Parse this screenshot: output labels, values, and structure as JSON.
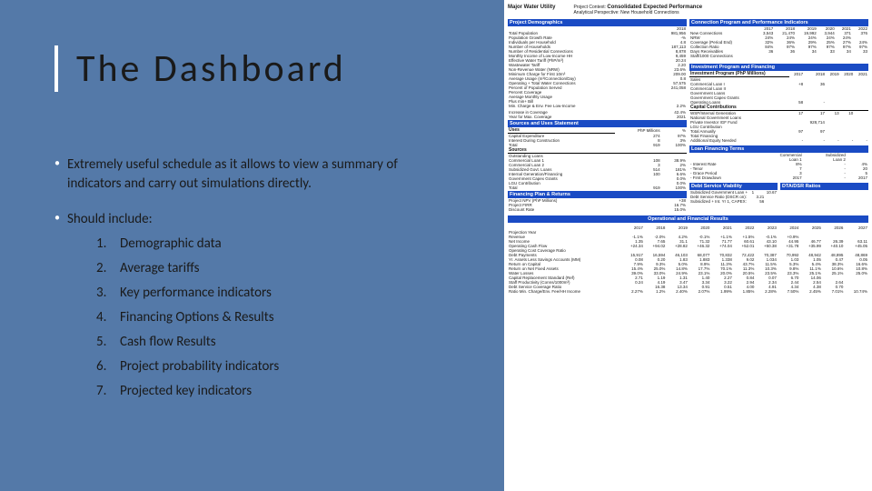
{
  "slide": {
    "title": "The Dashboard",
    "bullet1": "Extremely useful schedule as it allows to view a summary of indicators and carry out simulations directly.",
    "bullet2_lead": "Should include:",
    "list": [
      "Demographic data",
      "Average tariffs",
      "Key performance indicators",
      "Financing Options & Results",
      "Cash flow Results",
      "Project probability indicators",
      "Projected key indicators"
    ]
  },
  "dash": {
    "utility": "Major Water Utility",
    "ctx_l": "Project Context:",
    "ctx_r_title": "Consolidated Expected Performance",
    "persp": "Analytical Perspective:",
    "persp_val": "New Household Connections",
    "bar_demo": "Project Demographics",
    "bar_conn": "Connection Program and Performance Indicators",
    "bar_inv": "Investment Program and Financing",
    "bar_src": "Sources and Uses Statement",
    "bar_fin": "Financing Plan & Returns",
    "bar_lft": "Loan Financing Terms",
    "bar_dsv": "Debt Service Viability",
    "bar_dta": "DTA/DSR Ratios",
    "bar_op": "Operational and Financial Results",
    "demo": {
      "year": "2018",
      "rows": [
        [
          "Total Population",
          "981,956"
        ],
        [
          "Population Growth Rate",
          "-%"
        ],
        [
          "Individuals per Household",
          "4.8"
        ],
        [
          "Number of Households",
          "187,113"
        ],
        [
          "Number of Residential Connections",
          "8,878"
        ],
        [
          "Monthly Income of Low-Income HH",
          "9,459"
        ],
        [
          "Effective Water Tariff (PhP/m³)",
          "20.24"
        ],
        [
          "Wastewater Tariff",
          "2.20"
        ],
        [
          "Non-Revenue Water (NRW)",
          "23.6%"
        ],
        [
          "Minimum Charge for First 10m³",
          "209.00"
        ],
        [
          "Average Usage (m³/Connection/Day)",
          "0.8"
        ],
        [
          "Operating + Total Water Connections",
          "57,575"
        ],
        [
          "Percent of Population Served",
          "241,058"
        ],
        [
          "Percent Coverage",
          ""
        ],
        [
          "Average Monthly Usage",
          ""
        ],
        [
          "Plus min+ Bill",
          ""
        ],
        [
          "Min. Charge & Env. Fee Low-Income",
          "2.2%"
        ]
      ],
      "cov1": [
        "Increase in Coverage",
        "42.4%"
      ],
      "cov2": [
        "Year for Max. Coverage",
        "2021"
      ]
    },
    "conn": {
      "years": [
        "2017",
        "2018",
        "2019",
        "2020",
        "2021",
        "2022"
      ],
      "rows": [
        [
          "New Connections",
          "3,543",
          "21,470",
          "19,992",
          "3,944",
          "371",
          "376"
        ],
        [
          "NRW",
          "24%",
          "24%",
          "24%",
          "24%",
          "24%",
          ""
        ],
        [
          "Coverage (Period End)",
          "32%",
          "36%",
          "29%",
          "25%",
          "27%",
          "24%"
        ],
        [
          "Collection Ratio",
          "84%",
          "97%",
          "97%",
          "97%",
          "97%",
          "97%"
        ],
        [
          "Days Receivables",
          "36",
          "36",
          "34",
          "33",
          "34",
          "33"
        ],
        [
          "Staff/1000 Connections",
          "",
          "",
          "",
          "",
          "",
          ""
        ]
      ]
    },
    "inv": {
      "years": [
        "2017",
        "2018",
        "2019",
        "2020",
        "2021"
      ],
      "sec1": "Investment Program (PhP Millions)",
      "rows1": [
        [
          "Sales",
          "",
          "",
          " ",
          " ",
          " "
        ],
        [
          "Commercial Loan I",
          "+8",
          "36",
          " ",
          " ",
          " "
        ],
        [
          "Commercial Loan II",
          "",
          "",
          "",
          " ",
          " "
        ],
        [
          "Government Loans",
          "",
          "",
          "",
          " ",
          " "
        ],
        [
          "Government Capex Grants",
          "",
          "",
          "",
          " ",
          " "
        ],
        [
          "Operating Loans",
          "58",
          "-",
          "",
          " ",
          " "
        ]
      ],
      "sec2": "Capital Contributions",
      "rows2": [
        [
          "WSP/Internal Generation",
          "17",
          "17",
          "13",
          "10",
          " "
        ],
        [
          "National Government Loans",
          "",
          "",
          "",
          "",
          ""
        ],
        [
          "Private Investor IGF Fund",
          "",
          "928,714",
          "",
          "",
          ""
        ],
        [
          "LGU Contribution",
          "",
          "",
          "",
          "",
          ""
        ]
      ],
      "tot_ann": [
        "Total Annually",
        "97",
        "97",
        "",
        "",
        " "
      ],
      "tot_fin": [
        "Total Financing",
        "",
        "",
        "",
        "",
        ""
      ],
      "addl": [
        "Additional Equity Needed",
        "-",
        "-",
        "-",
        "-",
        "-"
      ]
    },
    "su": {
      "hdr": [
        "Uses",
        "PhP Millions",
        "%"
      ],
      "rows": [
        [
          "Capital Expenditure",
          "274",
          "97%"
        ],
        [
          "Interest During Construction",
          "8",
          "3%"
        ],
        [
          "Total",
          "919",
          "100%"
        ]
      ],
      "src_label": "Sources",
      "src": [
        [
          "Outstanding Loans",
          "",
          ""
        ],
        [
          "Commercial Loan 1",
          "108",
          "38.9%"
        ],
        [
          "Commercial Loan 2",
          "3",
          "2%"
        ],
        [
          "Subsidized Govt. Loans",
          "514",
          "181%"
        ],
        [
          "Internal Generation/Financing",
          "100",
          "6.6%"
        ],
        [
          "Government Capex Grants",
          "",
          "0.0%"
        ],
        [
          "LGU Contribution",
          "",
          "0.0%"
        ],
        [
          "Total",
          "919",
          "100%"
        ]
      ]
    },
    "finplan": {
      "rows": [
        [
          "Project NPV (PhP Millions)",
          "+38"
        ],
        [
          "Project FIRR",
          "16.7%"
        ],
        [
          "Discount Rate",
          "15.0%"
        ]
      ]
    },
    "lft": {
      "h": [
        "",
        "Commercial",
        "Subsidized"
      ],
      "rows": [
        [
          "",
          "Loan 1",
          "Loan 2"
        ],
        [
          "- Interest Rate",
          "8%",
          "-",
          "4%"
        ],
        [
          "- Tenor",
          "7",
          "-",
          "20"
        ],
        [
          "- Grace Period",
          "3",
          "-",
          "5"
        ],
        [
          "- First Drawdown",
          "2017",
          "-",
          "2017"
        ]
      ]
    },
    "dsv": {
      "rows": [
        [
          "Subsidized Government Loan +",
          "1",
          "",
          "10.67"
        ],
        [
          "Debt Service Ratio (DSCR on):",
          "",
          "3.21",
          ""
        ],
        [
          "Subsidized + Int. Yr 1, CAPEX:",
          "",
          "56",
          ""
        ]
      ]
    },
    "op": {
      "years": [
        "2017",
        "2018",
        "2019",
        "2020",
        "2021",
        "2022",
        "2023",
        "2024",
        "2025",
        "2026",
        "2027"
      ],
      "rows": [
        [
          "Projection Year",
          "",
          "",
          "",
          "",
          "",
          "",
          "",
          "",
          "",
          "",
          ""
        ],
        [
          "Revenue",
          "-1.1%",
          "-2.0%",
          "4.2%",
          "-0.1%",
          "+1.1%",
          "+1.5%",
          "-0.1%",
          "+0.9%",
          "",
          "",
          ""
        ],
        [
          "Net Income",
          "1.35",
          "7.65",
          "31.1",
          "71.32",
          "71.77",
          "60.61",
          "43.10",
          "44.95",
          "46.77",
          "26.39",
          "63.11"
        ],
        [
          "Operating Cash Flow",
          "+24.34",
          "+94.02",
          "+28.82",
          "+46.32",
          "+74.04",
          "+52.01",
          "+50.38",
          "+31.78",
          "+35.99",
          "+40.10",
          "+45.05"
        ],
        [
          "Operating Cost Coverage Ratio",
          "",
          "",
          "",
          "",
          "",
          "",
          "",
          "",
          "",
          "",
          ""
        ],
        [
          "Debt Payments",
          "15,917",
          "16,594",
          "46,103",
          "68,077",
          "70,832",
          "72,422",
          "70,387",
          "70,992",
          "48,942",
          "48,895",
          "48,869"
        ],
        [
          "Yr. Assets Less Savings Accounts (MM)",
          "0.08",
          "0.20",
          "1.83",
          "1.883",
          "1.338",
          "9.02",
          "1.034",
          "1.03",
          "1.05",
          "0.47",
          "0.05"
        ],
        [
          "Return on Capital",
          "7.9%",
          "9.3%",
          "5.0%",
          "8.9%",
          "11.3%",
          "43.7%",
          "11.5%",
          "5.3%",
          "5.4%",
          "38.3%",
          "16.6%"
        ],
        [
          "Return on Net Fixed Assets",
          "15.4%",
          "25.0%",
          "14.8%",
          "17.7%",
          "70.1%",
          "11.3%",
          "10.3%",
          "9.8%",
          "11.1%",
          "10.6%",
          "10.8%"
        ],
        [
          "Water Losses",
          "39.0%",
          "33.0%",
          "24.9%",
          "23.1%",
          "20.0%",
          "20.5%",
          "23.5%",
          "23.3%",
          "25.1%",
          "25.1%",
          "25.0%"
        ],
        [
          "Capital Replacement Standard (Ref)",
          "2.71",
          "1.19",
          "1.31",
          "1.40",
          "2.27",
          "0.84",
          "0.07",
          "6.70",
          "14.06",
          "",
          ""
        ],
        [
          "Staff Productivity (Conns/1000m³)",
          "0.24",
          "4.19",
          "3.47",
          "3.34",
          "3.22",
          "2.94",
          "2.34",
          "2.44",
          "2.54",
          "2.64",
          ""
        ],
        [
          "Debt Service Coverage Ratio",
          "",
          "16.38",
          "13.34",
          "0.91",
          "0.51",
          "4.00",
          "4.91",
          "4.34",
          "4.38",
          "0.70",
          ""
        ],
        [
          "Ratio Min. Charge/Env. Fee/HH Income",
          "2.27%",
          "1.2%",
          "2.40%",
          "2.07%",
          "1.99%",
          "1.85%",
          "2.28%",
          "7.50%",
          "2.45%",
          "7.01%",
          "10.74%"
        ]
      ]
    }
  }
}
